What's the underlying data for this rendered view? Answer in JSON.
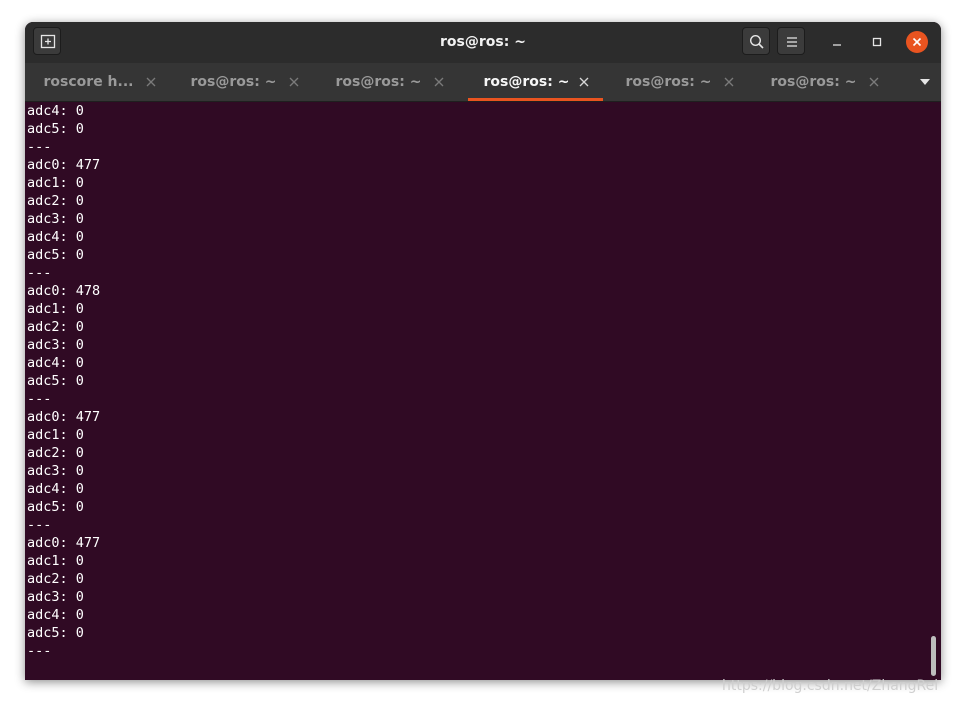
{
  "window": {
    "title": "ros@ros: ~"
  },
  "tabs": [
    {
      "label": "roscore h...",
      "active": false
    },
    {
      "label": "ros@ros: ~",
      "active": false
    },
    {
      "label": "ros@ros: ~",
      "active": false
    },
    {
      "label": "ros@ros: ~",
      "active": true
    },
    {
      "label": "ros@ros: ~",
      "active": false
    },
    {
      "label": "ros@ros: ~",
      "active": false
    }
  ],
  "icons": {
    "new_tab": "new-tab-icon",
    "search": "search-icon",
    "menu": "hamburger-menu-icon",
    "minimize": "minimize-icon",
    "maximize": "maximize-icon",
    "close": "close-icon",
    "tab_close": "close-icon",
    "tab_list": "chevron-down-icon"
  },
  "colors": {
    "terminal_bg": "#300a24",
    "accent": "#e95420",
    "titlebar_bg": "#2c2c2c",
    "tabbar_bg": "#353535"
  },
  "terminal": {
    "lines": [
      "adc4: 0",
      "adc5: 0",
      "---",
      "adc0: 477",
      "adc1: 0",
      "adc2: 0",
      "adc3: 0",
      "adc4: 0",
      "adc5: 0",
      "---",
      "adc0: 478",
      "adc1: 0",
      "adc2: 0",
      "adc3: 0",
      "adc4: 0",
      "adc5: 0",
      "---",
      "adc0: 477",
      "adc1: 0",
      "adc2: 0",
      "adc3: 0",
      "adc4: 0",
      "adc5: 0",
      "---",
      "adc0: 477",
      "adc1: 0",
      "adc2: 0",
      "adc3: 0",
      "adc4: 0",
      "adc5: 0",
      "---"
    ]
  },
  "watermark": "https://blog.csdn.net/ZhangRel"
}
